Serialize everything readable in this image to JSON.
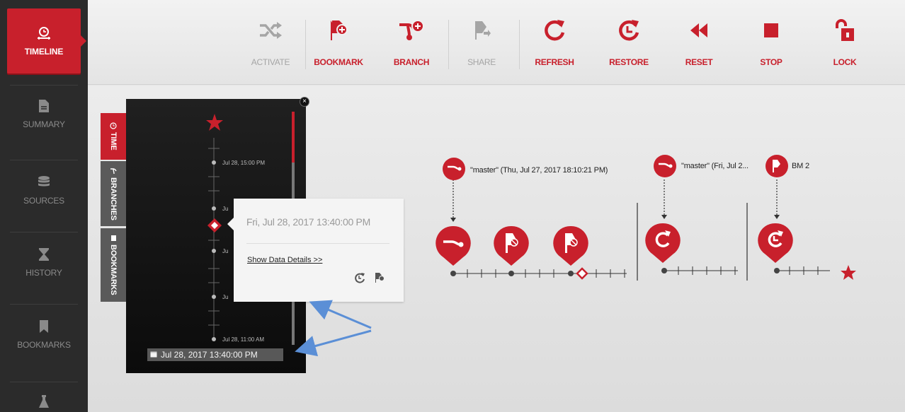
{
  "sidebar": {
    "items": [
      {
        "label": "TIMELINE",
        "icon": "timeline-icon"
      },
      {
        "label": "SUMMARY",
        "icon": "document-icon"
      },
      {
        "label": "SOURCES",
        "icon": "database-icon"
      },
      {
        "label": "HISTORY",
        "icon": "hourglass-icon"
      },
      {
        "label": "BOOKMARKS",
        "icon": "bookmark-icon"
      }
    ]
  },
  "toolbar": {
    "activate": "ACTIVATE",
    "bookmark": "BOOKMARK",
    "branch": "BRANCH",
    "share": "SHARE",
    "refresh": "REFRESH",
    "restore": "RESTORE",
    "reset": "RESET",
    "stop": "STOP",
    "lock": "LOCK"
  },
  "tabs": {
    "time": "TIME",
    "branches": "BRANCHES",
    "bookmarks": "BOOKMARKS"
  },
  "timeline": {
    "ticks": [
      "Jul 28, 15:00 PM",
      "Ju",
      "Ju",
      "Ju",
      "Jul 28, 11:00 AM"
    ],
    "selected_date": "Jul 28, 2017 13:40:00 PM"
  },
  "popover": {
    "date": "Fri, Jul 28, 2017 13:40:00 PM",
    "link": "Show Data Details >>"
  },
  "branches": {
    "label_1": "\"master\" (Thu, Jul 27, 2017 18:10:21 PM)",
    "label_2": "\"master\" (Fri, Jul 2...",
    "label_3": "BM 2"
  },
  "colors": {
    "accent": "#c8202c",
    "sidebar_bg": "#2b2b2b",
    "disabled": "#a5a5a5",
    "annotation_arrow": "#5b8fd6"
  }
}
